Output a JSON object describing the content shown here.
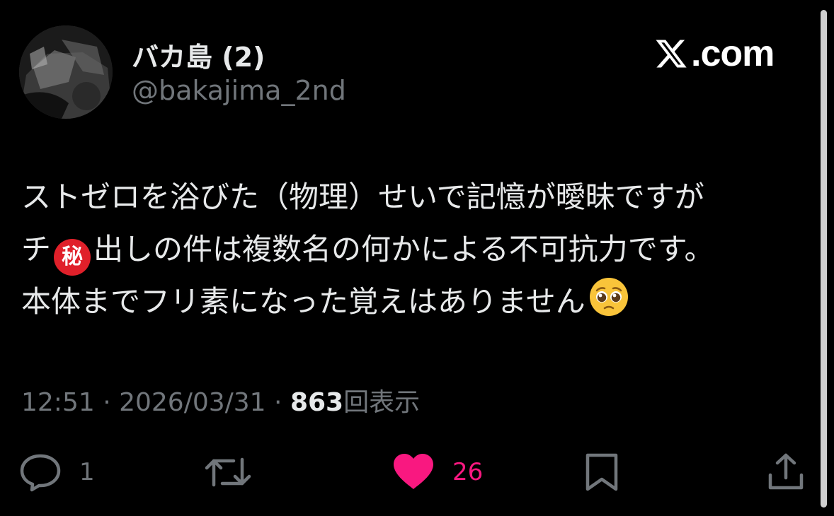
{
  "author": {
    "display_name": "バカ島 (2)",
    "handle": "@bakajima_2nd",
    "avatar_icon": "profile-photo"
  },
  "brand": {
    "text": "com",
    "logo_icon": "x-logo-icon"
  },
  "tweet": {
    "line1": "ストゼロを浴びた（物理）せいで記憶が曖昧ですが",
    "line2_prefix": "チ",
    "line2_emoji": "秘",
    "line2_suffix": "出しの件は複数名の何かによる不可抗力です。",
    "line3": "本体までフリ素になった覚えはありません",
    "line3_emoji_icon": "pleading-face-emoji"
  },
  "meta": {
    "time": "12:51",
    "separator": " · ",
    "date": "2026/03/31",
    "views_count": "863",
    "views_label": "回表示"
  },
  "actions": {
    "reply_count": "1",
    "like_count": "26",
    "liked": true,
    "like_color": "#f91880"
  },
  "colors": {
    "background": "#000000",
    "text_primary": "#e7e9ea",
    "text_secondary": "#71767b"
  }
}
